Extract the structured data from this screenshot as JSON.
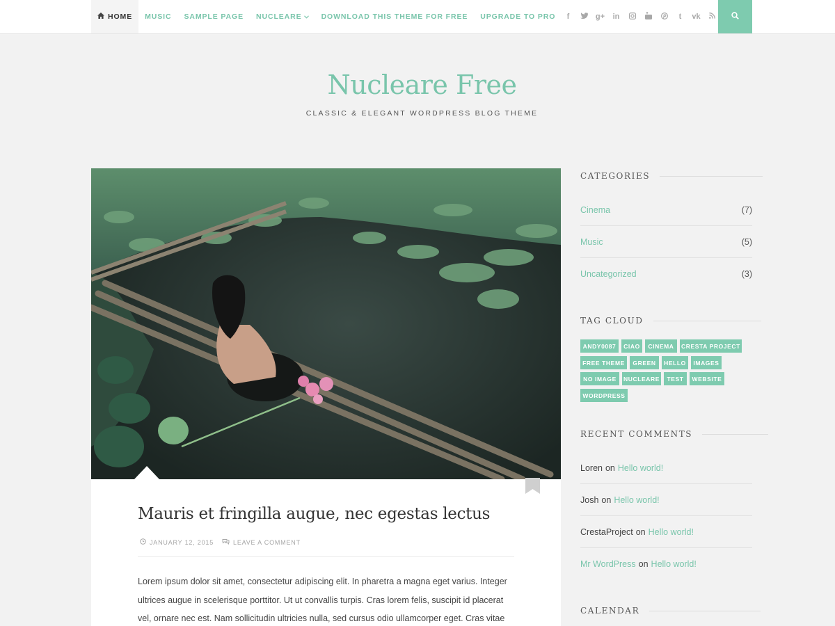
{
  "nav": {
    "items": [
      {
        "label": "HOME"
      },
      {
        "label": "MUSIC"
      },
      {
        "label": "SAMPLE PAGE"
      },
      {
        "label": "NUCLEARE"
      },
      {
        "label": "DOWNLOAD THIS THEME FOR FREE"
      },
      {
        "label": "UPGRADE TO PRO"
      }
    ],
    "social": [
      "facebook-icon",
      "twitter-icon",
      "google-plus-icon",
      "linkedin-icon",
      "instagram-icon",
      "youtube-icon",
      "pinterest-icon",
      "tumblr-icon",
      "vk-icon",
      "rss-icon"
    ],
    "social_glyphs": [
      "f",
      "🐦",
      "g+",
      "in",
      "◘",
      "▶",
      "℗",
      "t",
      "vk",
      "))"
    ]
  },
  "header": {
    "title": "Nucleare Free",
    "tagline": "CLASSIC & ELEGANT WORDPRESS BLOG THEME"
  },
  "post": {
    "title": "Mauris et fringilla augue, nec egestas lectus",
    "date": "JANUARY 12, 2015",
    "comments_link": "LEAVE A COMMENT",
    "excerpt": "Lorem ipsum dolor sit amet, consectetur adipiscing elit. In pharetra a magna eget varius. Integer ultrices augue in scelerisque porttitor. Ut ut convallis turpis. Cras lorem felis, suscipit id placerat vel, ornare nec est. Nam sollicitudin ultricies nulla, sed cursus odio ullamcorper eget. Cras vitae neque ac nunc vulputate consectetur vel"
  },
  "sidebar": {
    "categories": {
      "title": "CATEGORIES",
      "items": [
        {
          "name": "Cinema",
          "count": "(7)"
        },
        {
          "name": "Music",
          "count": "(5)"
        },
        {
          "name": "Uncategorized",
          "count": "(3)"
        }
      ]
    },
    "tag_cloud": {
      "title": "TAG CLOUD",
      "tags": [
        "ANDY0087",
        "CIAO",
        "CINEMA",
        "CRESTA PROJECT",
        "FREE THEME",
        "GREEN",
        "HELLO",
        "IMAGES",
        "NO IMAGE",
        "NUCLEARE",
        "TEST",
        "WEBSITE",
        "WORDPRESS"
      ]
    },
    "recent_comments": {
      "title": "RECENT COMMENTS",
      "on_word": "on",
      "items": [
        {
          "author": "Loren",
          "post": "Hello world!"
        },
        {
          "author": "Josh",
          "post": "Hello world!"
        },
        {
          "author": "CrestaProject",
          "post": "Hello world!"
        },
        {
          "author": "Mr WordPress",
          "post": "Hello world!"
        }
      ]
    },
    "calendar": {
      "title": "CALENDAR"
    }
  },
  "colors": {
    "accent": "#7ecbaf",
    "text": "#444444",
    "background": "#f2f2f2"
  }
}
